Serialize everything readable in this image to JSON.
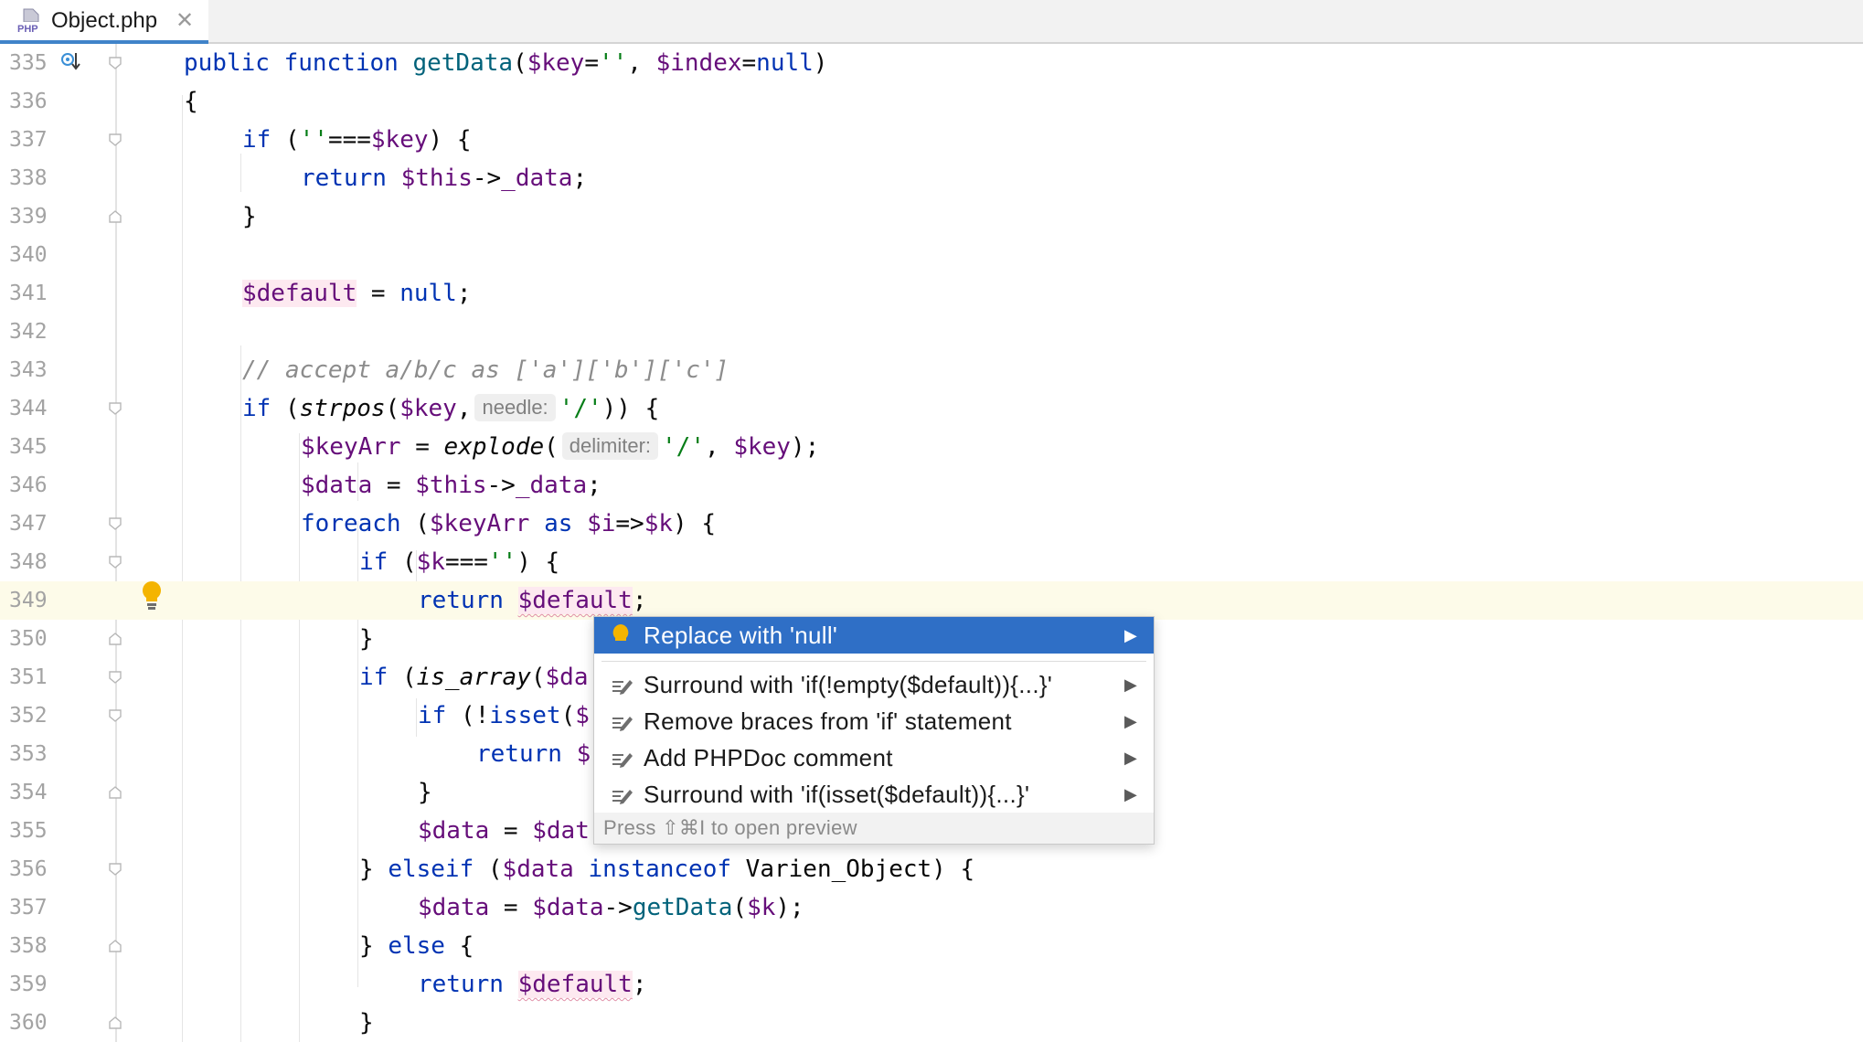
{
  "tab": {
    "file_name": "Object.php",
    "icon": "php-file-icon",
    "close_label": "✕"
  },
  "lines": [
    {
      "n": "335"
    },
    {
      "n": "336"
    },
    {
      "n": "337"
    },
    {
      "n": "338"
    },
    {
      "n": "339"
    },
    {
      "n": "340"
    },
    {
      "n": "341"
    },
    {
      "n": "342"
    },
    {
      "n": "343"
    },
    {
      "n": "344"
    },
    {
      "n": "345"
    },
    {
      "n": "346"
    },
    {
      "n": "347"
    },
    {
      "n": "348"
    },
    {
      "n": "349"
    },
    {
      "n": "350"
    },
    {
      "n": "351"
    },
    {
      "n": "352"
    },
    {
      "n": "353"
    },
    {
      "n": "354"
    },
    {
      "n": "355"
    },
    {
      "n": "356"
    },
    {
      "n": "357"
    },
    {
      "n": "358"
    },
    {
      "n": "359"
    },
    {
      "n": "360"
    }
  ],
  "code": {
    "l335_kw": "public function ",
    "l335_fn": "getData",
    "l335_a": "(",
    "l335_v1": "$key",
    "l335_b": "=",
    "l335_s1": "''",
    "l335_c": ", ",
    "l335_v2": "$index",
    "l335_d": "=",
    "l335_k2": "null",
    "l335_e": ")",
    "l336": "{",
    "l337_kw": "if",
    "l337_a": " (",
    "l337_s": "''",
    "l337_b": "===",
    "l337_v": "$key",
    "l337_c": ") {",
    "l338_kw": "return ",
    "l338_v": "$this",
    "l338_a": "->",
    "l338_p": "_data",
    "l338_b": ";",
    "l339": "}",
    "l341_v": "$default",
    "l341_a": " = ",
    "l341_k": "null",
    "l341_b": ";",
    "l343": "// accept a/b/c as ['a']['b']['c']",
    "l344_kw": "if",
    "l344_a": " (",
    "l344_fn": "strpos",
    "l344_b": "(",
    "l344_v": "$key",
    "l344_c": ",",
    "l344_hint": "needle:",
    "l344_s": "'/'",
    "l344_d": ")) {",
    "l345_v": "$keyArr",
    "l345_a": " = ",
    "l345_fn": "explode",
    "l345_b": "(",
    "l345_hint": "delimiter:",
    "l345_s": "'/'",
    "l345_c": ", ",
    "l345_v2": "$key",
    "l345_d": ");",
    "l346_v": "$data",
    "l346_a": " = ",
    "l346_v2": "$this",
    "l346_b": "->",
    "l346_p": "_data",
    "l346_c": ";",
    "l347_kw": "foreach",
    "l347_a": " (",
    "l347_v": "$keyArr",
    "l347_as": " as ",
    "l347_v2": "$i",
    "l347_b": "=>",
    "l347_v3": "$k",
    "l347_c": ") {",
    "l348_kw": "if",
    "l348_a": " (",
    "l348_v": "$k",
    "l348_b": "===",
    "l348_s": "''",
    "l348_c": ") {",
    "l349_kw": "return ",
    "l349_v": "$default",
    "l349_a": ";",
    "l350": "}",
    "l351_kw": "if",
    "l351_a": " (",
    "l351_fn": "is_array",
    "l351_b": "(",
    "l351_v": "$da",
    "l352_kw": "if",
    "l352_a": " (!",
    "l352_fn": "isset",
    "l352_b": "(",
    "l352_v": "$",
    "l353_kw": "return ",
    "l353_v": "$",
    "l354": "}",
    "l355_v": "$data",
    "l355_a": " = ",
    "l355_v2": "$dat",
    "l356_a": "} ",
    "l356_kw": "elseif",
    "l356_b": " (",
    "l356_v": "$data",
    "l356_kw2": " instanceof ",
    "l356_c": "Varien_Object",
    "l356_d": ") {",
    "l357_v": "$data",
    "l357_a": " = ",
    "l357_v2": "$data",
    "l357_b": "->",
    "l357_fn": "getData",
    "l357_c": "(",
    "l357_v3": "$k",
    "l357_d": ");",
    "l358_a": "} ",
    "l358_kw": "else",
    "l358_b": " {",
    "l359_kw": "return ",
    "l359_v": "$default",
    "l359_a": ";",
    "l360": "}"
  },
  "popup": {
    "items": [
      {
        "label": "Replace with 'null'",
        "icon": "lightbulb-icon",
        "arrow": "▶"
      },
      {
        "label": "Surround with 'if(!empty($default)){...}'",
        "icon": "edit-intention-icon",
        "arrow": "▶"
      },
      {
        "label": "Remove braces from 'if' statement",
        "icon": "edit-intention-icon",
        "arrow": "▶"
      },
      {
        "label": "Add PHPDoc comment",
        "icon": "edit-intention-icon",
        "arrow": "▶"
      },
      {
        "label": "Surround with 'if(isset($default)){...}'",
        "icon": "edit-intention-icon",
        "arrow": "▶"
      }
    ],
    "footer": "Press ⇧⌘I to open preview"
  },
  "colors": {
    "selection": "#2f6fc6",
    "caret_row": "#fdfbe9",
    "keyword": "#0033b3",
    "variable": "#660e7a",
    "string": "#067d17"
  }
}
